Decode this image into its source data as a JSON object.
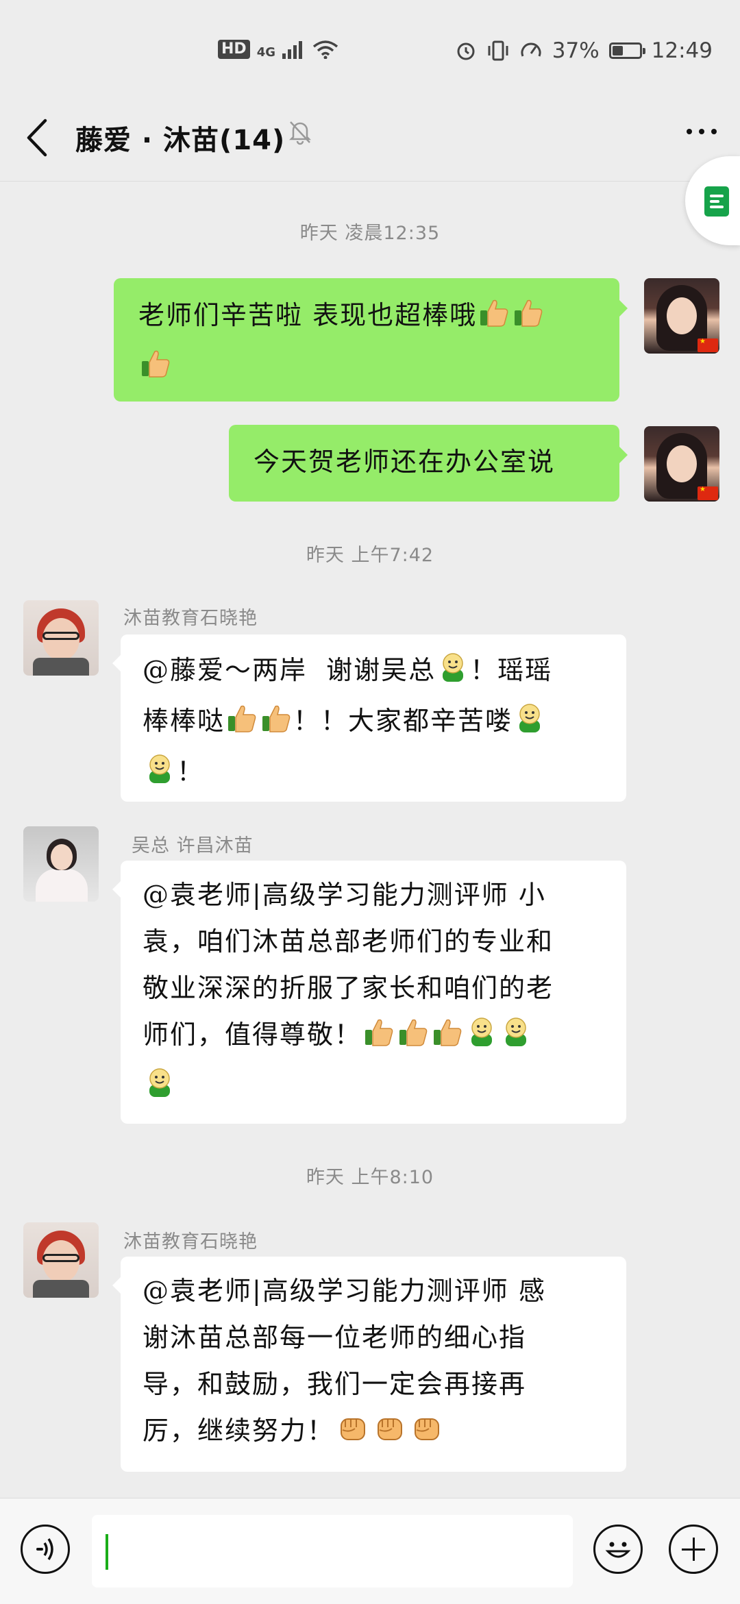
{
  "status_bar": {
    "hd": "HD",
    "network": "4G",
    "battery_percent": "37%",
    "battery_level": 0.37,
    "time": "12:49"
  },
  "header": {
    "title": "藤爱 · 沐苗(14)",
    "icons": [
      "back-arrow-icon",
      "mute-bell-icon",
      "more-dots-icon"
    ]
  },
  "floating": {
    "icon": "note-doc-icon",
    "color": "#16a34a"
  },
  "messages": [
    {
      "type": "time",
      "text": "昨天 凌晨12:35"
    },
    {
      "type": "me",
      "text": "老师们辛苦啦 表现也超棒哦",
      "emojis_after": [
        "thumbs-up",
        "thumbs-up",
        "thumbs-up"
      ]
    },
    {
      "type": "me",
      "text": "今天贺老师还在办公室说"
    },
    {
      "type": "time",
      "text": "昨天 上午7:42"
    },
    {
      "type": "other",
      "sender": "沐苗教育石晓艳",
      "text": "@藤爱～两岸  谢谢吴总[愉快]！瑶瑶棒棒哒[强][强]！！大家都辛苦喽[愉快][愉快]！"
    },
    {
      "type": "other",
      "sender": "吴总 许昌沐苗",
      "text": "@袁老师|高级学习能力测评师 小袁，咱们沐苗总部老师们的专业和敬业深深的折服了家长和咱们的老师们，值得尊敬！[强][强][强][愉快][愉快][愉快]"
    },
    {
      "type": "time",
      "text": "昨天 上午8:10"
    },
    {
      "type": "other",
      "sender": "沐苗教育石晓艳",
      "text": "@袁老师|高级学习能力测评师 感谢沐苗总部每一位老师的细心指导，和鼓励，我们一定会再接再厉，继续努力！[拳头][拳头][拳头]"
    }
  ],
  "bubble_lines": {
    "m1": [
      "老师们辛苦啦 表现也超棒哦",
      ""
    ],
    "m2": [
      "今天贺老师还在办公室说"
    ],
    "m3": [
      "@藤爱～两岸  谢谢吴总",
      "！瑶瑶",
      "棒棒哒",
      "！！大家都辛苦喽",
      "！"
    ],
    "m4": [
      "@袁老师|高级学习能力测评师 小",
      "袁，咱们沐苗总部老师们的专业和",
      "敬业深深的折服了家长和咱们的老",
      "师们，值得尊敬！"
    ],
    "m5": [
      "@袁老师|高级学习能力测评师 感",
      "谢沐苗总部每一位老师的细心指",
      "导，和鼓励，我们一定会再接再",
      "厉，继续努力！"
    ]
  },
  "input_bar": {
    "icons": [
      "voice-icon",
      "emoji-icon",
      "plus-icon"
    ],
    "value": ""
  },
  "colors": {
    "background": "#ededed",
    "my_bubble": "#95ec69",
    "other_bubble": "#ffffff",
    "accent": "#1aad19"
  }
}
